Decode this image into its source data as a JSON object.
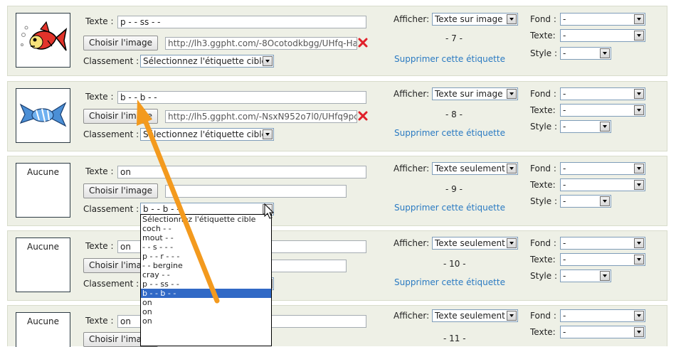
{
  "labels": {
    "texte": "Texte :",
    "choisir": "Choisir l'image",
    "classement": "Classement :",
    "afficher": "Afficher:",
    "fond": "Fond :",
    "texte2": "Texte:",
    "style": "Style :",
    "supprimer": "Supprimer cette étiquette",
    "aucune": "Aucune"
  },
  "rows": [
    {
      "texte_value": "p - - ss - -",
      "url": "http://lh3.ggpht.com/-8Ocotodkbgg/UHfq-Ha",
      "classement": "Sélectionnez l'étiquette cible",
      "afficher": "Texte sur image",
      "fond": "-",
      "texte_opt": "-",
      "style": "-",
      "number": "- 7 -",
      "thumb": "fish"
    },
    {
      "texte_value": "b - - b - -",
      "url": "http://lh5.ggpht.com/-NsxN952o7l0/UHfq9pc",
      "classement": "Sélectionnez l'étiquette cible",
      "afficher": "Texte sur image",
      "fond": "-",
      "texte_opt": "-",
      "style": "-",
      "number": "- 8 -",
      "thumb": "candy"
    },
    {
      "texte_value": "on",
      "url": "",
      "classement": "b - - b - -",
      "afficher": "Texte seulement",
      "fond": "-",
      "texte_opt": "-",
      "style": "-",
      "number": "- 9 -",
      "thumb": "none"
    },
    {
      "texte_value": "on",
      "url": "",
      "classement": "",
      "afficher": "Texte seulement",
      "fond": "-",
      "texte_opt": "-",
      "style": "-",
      "number": "- 10 -",
      "thumb": "none"
    },
    {
      "texte_value": "on",
      "url": "",
      "classement": "",
      "afficher": "Texte seulement",
      "fond": "-",
      "texte_opt": "-",
      "number": "- 11 -",
      "thumb": "none"
    }
  ],
  "dropdown_options": [
    "Sélectionnez l'étiquette cible",
    "coch - -",
    "mout - -",
    "- - s - - -",
    "p - - r - - -",
    "- - bergine",
    "cray - -",
    "p - - ss - -",
    "b - - b - -",
    "on",
    "on",
    "on"
  ],
  "dropdown_selected_index": 8,
  "colors": {
    "row_bg": "#eef0e6",
    "link": "#2a7ac2",
    "arrow": "#f39a1e",
    "selection": "#3169c6",
    "delete": "#e0202a"
  }
}
